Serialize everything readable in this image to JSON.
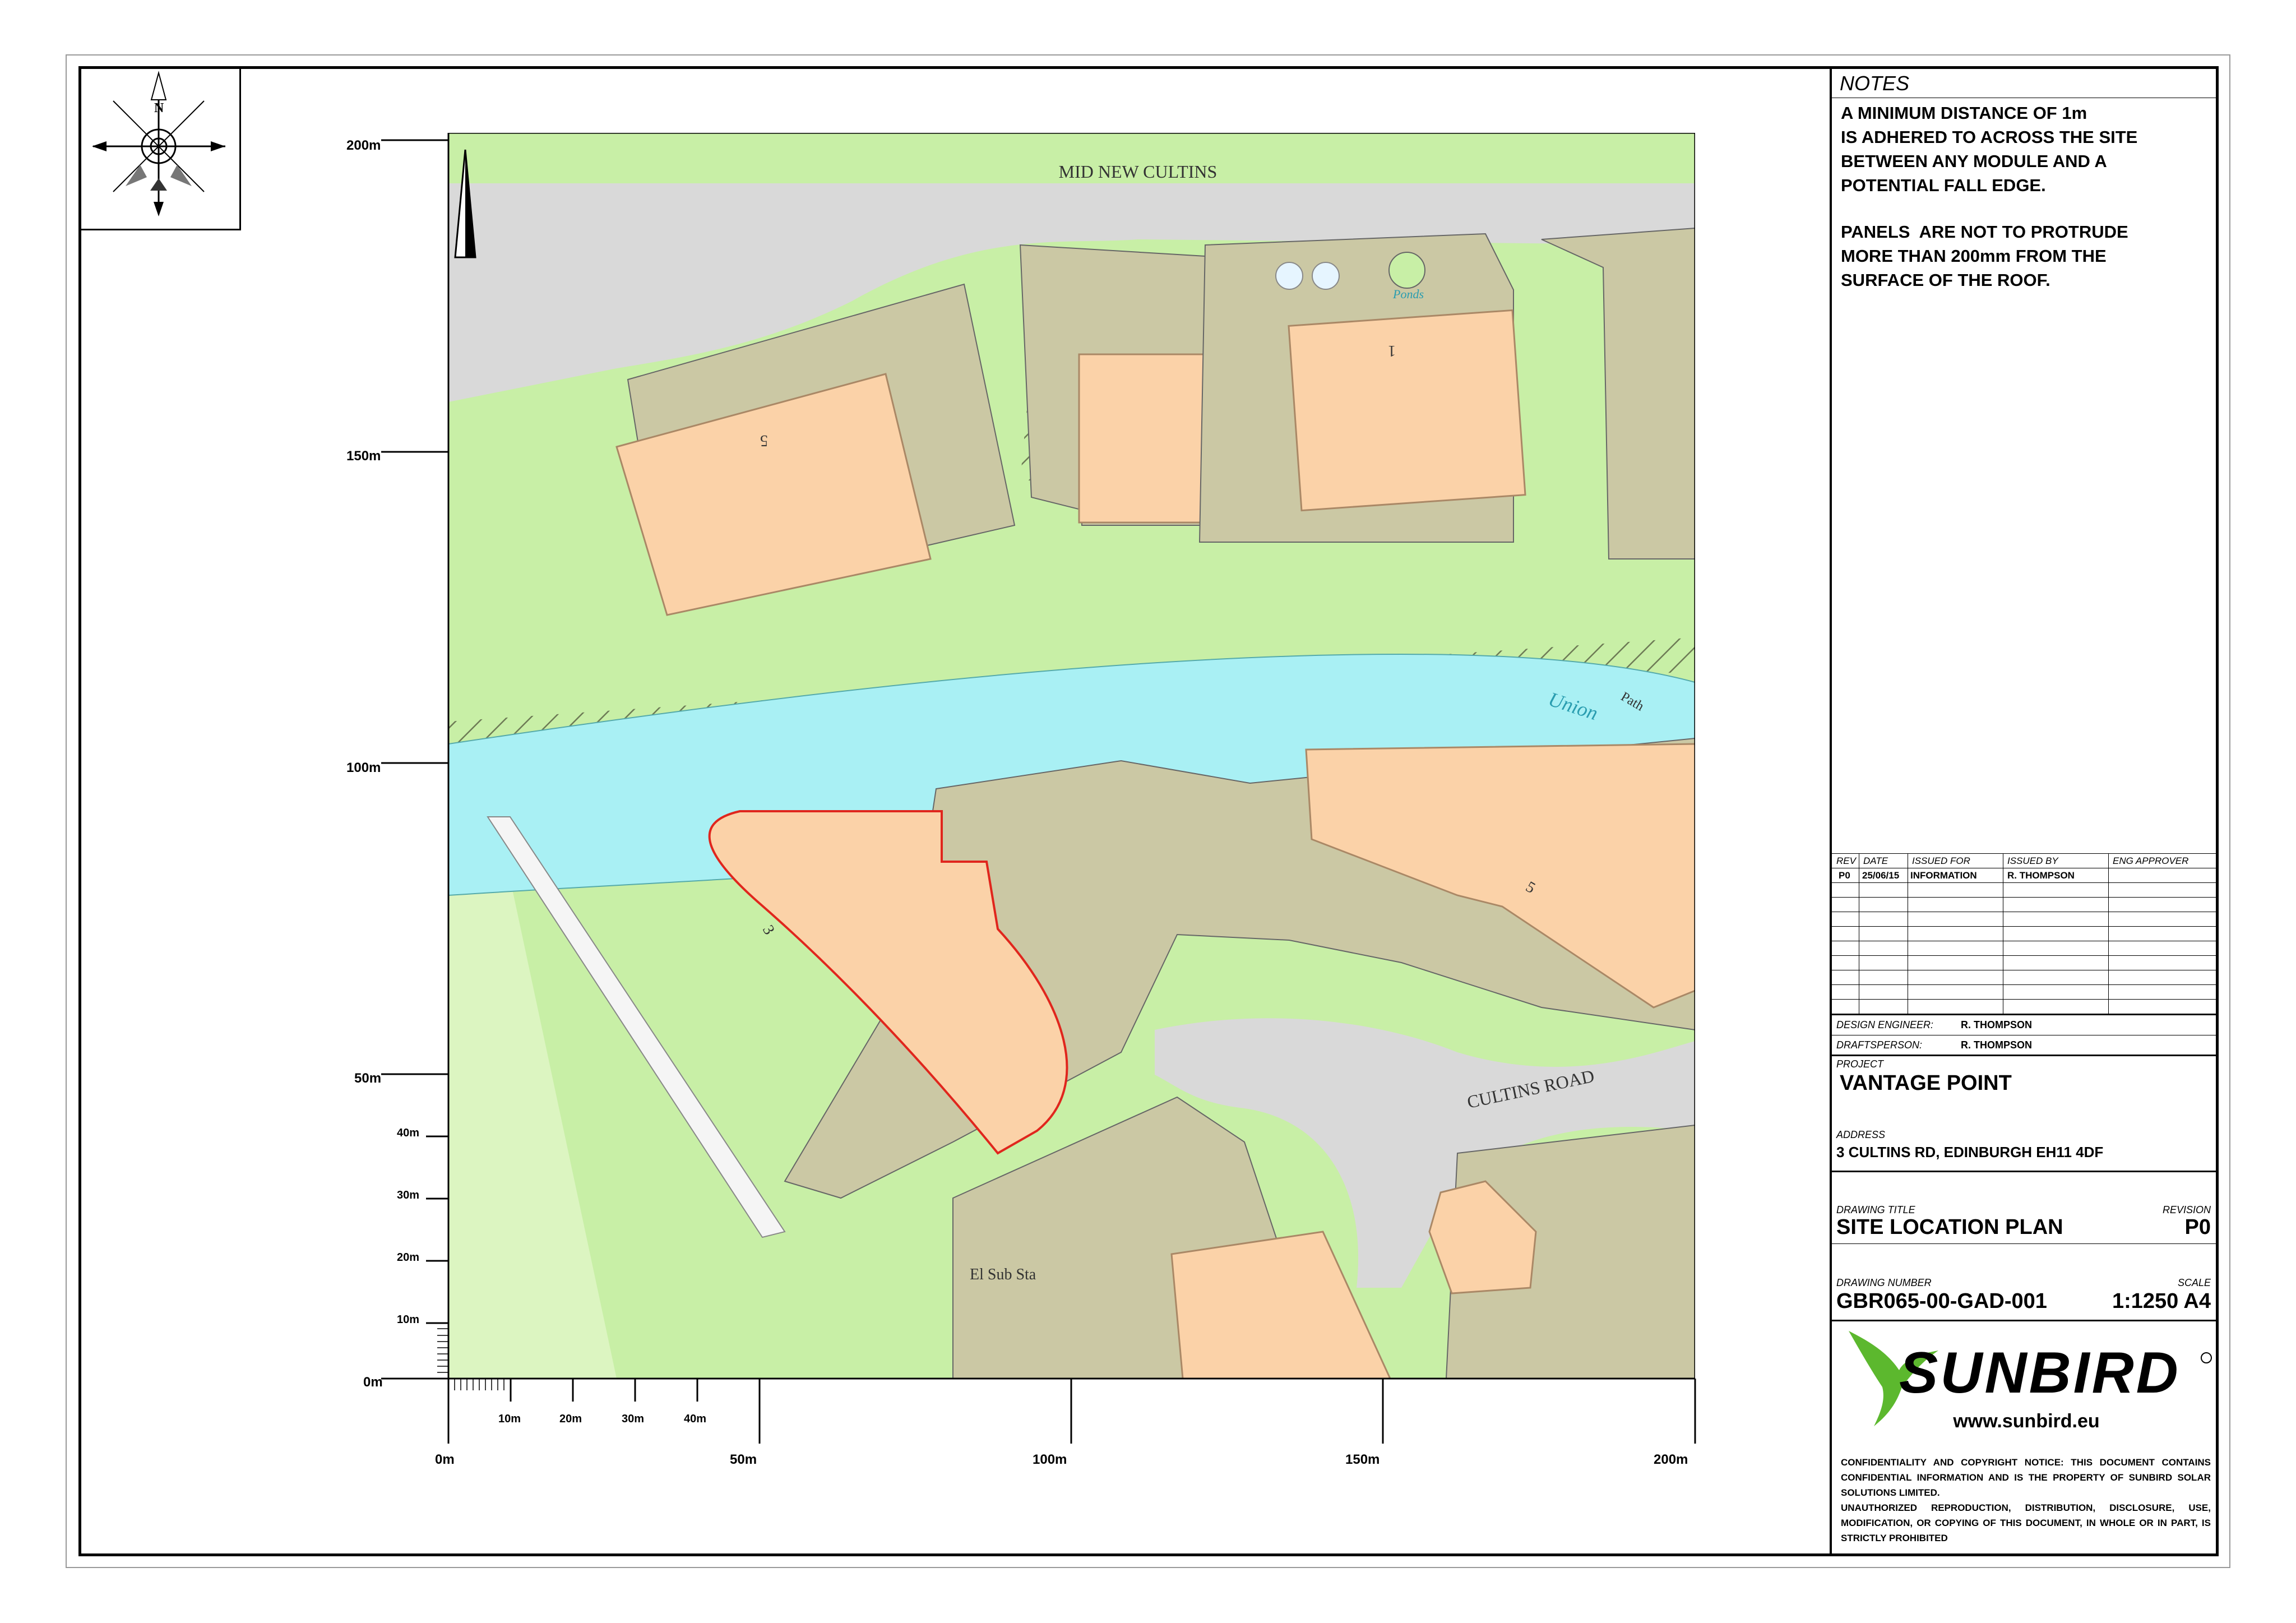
{
  "map": {
    "north_label": "N",
    "labels": {
      "mid_new_cultins": "MID NEW CULTINS",
      "ponds": "Ponds",
      "bldg_a": "5",
      "bldg_b": "1",
      "union": "Union",
      "path": "Path",
      "bldg_c": "3",
      "bldg_d": "5",
      "cultins_road": "CULTINS ROAD",
      "el_sub_sta": "El Sub Sta"
    },
    "colors": {
      "grass": "#c8efa6",
      "building": "#cbc8a4",
      "roof": "#fbd2a8",
      "road": "#d9d9d9",
      "water": "#a9f0f4",
      "boundary": "#e0261d"
    }
  },
  "scale": {
    "left": [
      "200m",
      "150m",
      "100m",
      "50m",
      "40m",
      "30m",
      "20m",
      "10m",
      "0m"
    ],
    "bottom": [
      "0m",
      "10m",
      "20m",
      "30m",
      "40m",
      "50m",
      "100m",
      "150m",
      "200m"
    ]
  },
  "notes": {
    "heading": "NOTES",
    "para1": "A MINIMUM DISTANCE OF 1m\nIS ADHERED TO ACROSS THE SITE\nBETWEEN ANY MODULE AND A\nPOTENTIAL FALL EDGE.",
    "para2": "PANELS  ARE NOT TO PROTRUDE\nMORE THAN 200mm FROM THE\nSURFACE OF THE ROOF."
  },
  "revisions": {
    "headers": [
      "REV",
      "DATE",
      "ISSUED FOR",
      "ISSUED BY",
      "ENG APPROVER"
    ],
    "rows": [
      [
        "P0",
        "25/06/15",
        "INFORMATION",
        "R. THOMPSON",
        ""
      ]
    ]
  },
  "people": {
    "design_engineer_label": "DESIGN ENGINEER:",
    "design_engineer": "R. THOMPSON",
    "draftsperson_label": "DRAFTSPERSON:",
    "draftsperson": "R. THOMPSON"
  },
  "project": {
    "label": "PROJECT",
    "name": "VANTAGE POINT"
  },
  "address": {
    "label": "ADDRESS",
    "value": "3 CULTINS RD, EDINBURGH EH11 4DF"
  },
  "drawing": {
    "title_label": "DRAWING TITLE",
    "title": "SITE LOCATION PLAN",
    "revision_label": "REVISION",
    "revision": "P0",
    "number_label": "DRAWING NUMBER",
    "number": "GBR065-00-GAD-001",
    "scale_label": "SCALE",
    "scale": "1:1250 A4"
  },
  "brand": {
    "name": "SUNBIRD",
    "url": "www.sunbird.eu",
    "accent": "#5cb82e"
  },
  "confidentiality": {
    "p1": "CONFIDENTIALITY AND COPYRIGHT NOTICE: THIS DOCUMENT CONTAINS CONFIDENTIAL INFORMATION AND IS THE PROPERTY OF SUNBIRD SOLAR SOLUTIONS LIMITED.",
    "p2": "UNAUTHORIZED REPRODUCTION, DISTRIBUTION, DISCLOSURE, USE, MODIFICATION, OR COPYING OF THIS DOCUMENT, IN WHOLE OR IN PART, IS STRICTLY PROHIBITED"
  }
}
